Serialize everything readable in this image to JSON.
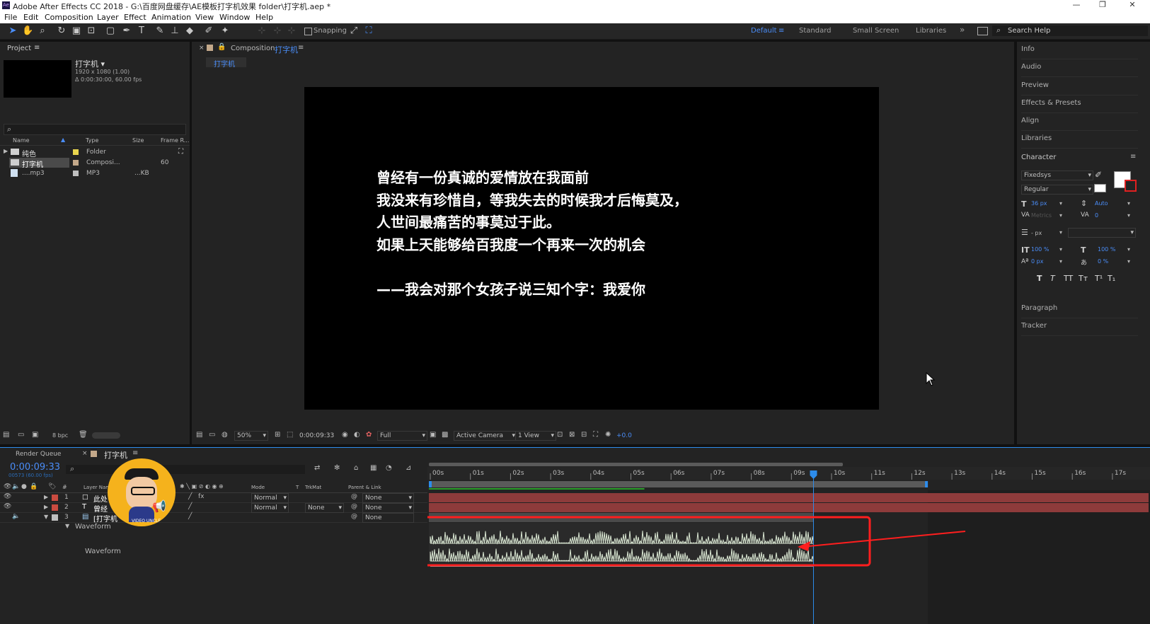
{
  "window": {
    "title": "Adobe After Effects CC 2018 - G:\\百度网盘缓存\\AE模板打字机效果 folder\\打字机.aep *",
    "controls": [
      "—",
      "❐",
      "✕"
    ]
  },
  "menu": [
    "File",
    "Edit",
    "Composition",
    "Layer",
    "Effect",
    "Animation",
    "View",
    "Window",
    "Help"
  ],
  "toolbar": {
    "snapping_label": "Snapping",
    "workspaces": [
      "Default",
      "Standard",
      "Small Screen",
      "Libraries"
    ],
    "more": "»",
    "search_placeholder": "Search Help"
  },
  "project": {
    "tab": "Project",
    "comp_name": "打字机 ▾",
    "comp_info1": "1920 x 1080 (1.00)",
    "comp_info2": "Δ 0:00:30:00, 60.00 fps",
    "columns": [
      "Name",
      "Type",
      "Size",
      "Frame R..."
    ],
    "items": [
      {
        "name": "纯色",
        "type": "Folder",
        "size": "",
        "fr": "",
        "color": "#e8d44d"
      },
      {
        "name": "打字机",
        "type": "Composi...",
        "size": "",
        "fr": "60",
        "color": "#c3a88a"
      },
      {
        "name": "....mp3",
        "type": "MP3",
        "size": "...KB",
        "fr": "",
        "color": "#bfbfbf"
      }
    ],
    "bpc": "8 bpc"
  },
  "composition": {
    "tab_prefix": "Composition",
    "tab_name": "打字机",
    "subtab": "打字机",
    "lines": [
      "曾经有一份真诚的爱情放在我面前",
      "我没来有珍惜自，等我失去的时候我才后悔莫及，",
      "人世间最痛苦的事莫过于此。",
      "如果上天能够给百我度一个再来一次的机会",
      "",
      "——我会对那个女孩子说三知个字：我爱你"
    ],
    "footer": {
      "zoom": "50%",
      "timecode": "0:00:09:33",
      "resolution": "Full",
      "camera": "Active Camera",
      "views": "1 View",
      "exposure": "+0.0"
    }
  },
  "right_panels": [
    "Info",
    "Audio",
    "Preview",
    "Effects & Presets",
    "Align",
    "Libraries"
  ],
  "character": {
    "title": "Character",
    "font": "Fixedsys",
    "style": "Regular",
    "size": "36 px",
    "leading": "Auto",
    "kerning": "Metrics",
    "tracking": "0",
    "stroke": "- px",
    "vscale": "100 %",
    "hscale": "100 %",
    "baseline": "0 px",
    "tsume": "0 %",
    "styles": [
      "T",
      "T",
      "TT",
      "Tт",
      "T¹",
      "T₁"
    ]
  },
  "bottom_panels": [
    "Paragraph",
    "Tracker"
  ],
  "timeline": {
    "tabs": [
      "Render Queue",
      "打字机"
    ],
    "timecode": "0:00:09:33",
    "frames": "00573 (60.00 fps)",
    "col_headers": [
      "Layer Name",
      "Mode",
      "T",
      "TrkMat",
      "Parent & Link"
    ],
    "layers": [
      {
        "num": "1",
        "name": "此处",
        "color": "#c94b40",
        "mode": "Normal",
        "trk": "",
        "parent": "None",
        "icon": "□"
      },
      {
        "num": "2",
        "name": "曾经",
        "color": "#c94b40",
        "mode": "Normal",
        "trk": "None",
        "parent": "None",
        "icon": "T"
      },
      {
        "num": "3",
        "name": "[打字机",
        "color": "#bfbfbf",
        "mode": "",
        "trk": "",
        "parent": "None",
        "icon": "▤"
      }
    ],
    "waveform_group": "Waveform",
    "waveform_prop": "Waveform",
    "ruler": [
      "00s",
      "01s",
      "02s",
      "03s",
      "04s",
      "05s",
      "06s",
      "07s",
      "08s",
      "09s",
      "10s",
      "11s",
      "12s",
      "13s",
      "14s",
      "15s",
      "16s",
      "17s"
    ],
    "playhead_seconds": 9.55,
    "work_area_end_seconds": 12.4
  },
  "watermark": "VIDEO UNCLE",
  "colors": {
    "accent": "#2d8ceb",
    "highlight": "#ff1e1e",
    "layer_bar": "#8e3b3b",
    "waveform": "#d9e6d2"
  }
}
